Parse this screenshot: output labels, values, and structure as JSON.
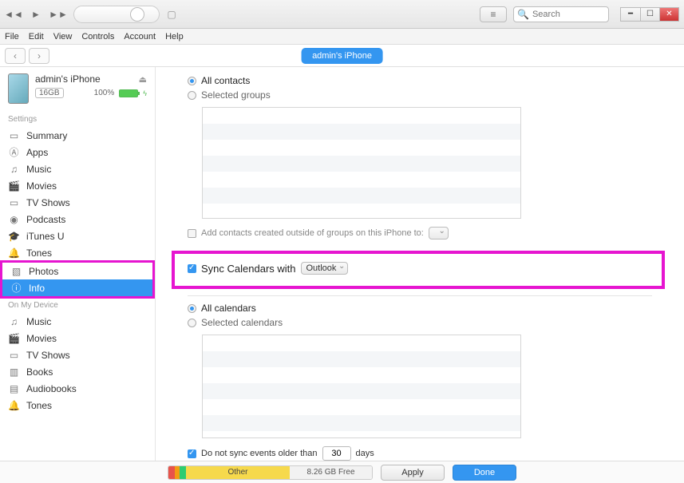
{
  "titlebar": {
    "search_placeholder": "Search"
  },
  "menubar": [
    "File",
    "Edit",
    "View",
    "Controls",
    "Account",
    "Help"
  ],
  "device_pill": "admin's iPhone",
  "device": {
    "name": "admin's iPhone",
    "capacity": "16GB",
    "battery_pct": "100%"
  },
  "sidebar": {
    "settings_label": "Settings",
    "settings_items": [
      {
        "icon": "summary",
        "label": "Summary"
      },
      {
        "icon": "apps",
        "label": "Apps"
      },
      {
        "icon": "music",
        "label": "Music"
      },
      {
        "icon": "movies",
        "label": "Movies"
      },
      {
        "icon": "tvshows",
        "label": "TV Shows"
      },
      {
        "icon": "podcasts",
        "label": "Podcasts"
      },
      {
        "icon": "itunesu",
        "label": "iTunes U"
      },
      {
        "icon": "tones",
        "label": "Tones"
      },
      {
        "icon": "photos",
        "label": "Photos"
      },
      {
        "icon": "info",
        "label": "Info"
      }
    ],
    "ondevice_label": "On My Device",
    "ondevice_items": [
      {
        "icon": "music",
        "label": "Music"
      },
      {
        "icon": "movies",
        "label": "Movies"
      },
      {
        "icon": "tvshows",
        "label": "TV Shows"
      },
      {
        "icon": "books",
        "label": "Books"
      },
      {
        "icon": "audiobooks",
        "label": "Audiobooks"
      },
      {
        "icon": "tones",
        "label": "Tones"
      }
    ]
  },
  "contacts": {
    "all_label": "All contacts",
    "selected_label": "Selected groups",
    "add_outside_label": "Add contacts created outside of groups on this iPhone to:"
  },
  "calendars": {
    "headline": "Sync Calendars with",
    "app": "Outlook",
    "all_label": "All calendars",
    "selected_label": "Selected calendars",
    "older_label_pre": "Do not sync events older than",
    "older_days": "30",
    "older_label_post": "days"
  },
  "footer": {
    "other_label": "Other",
    "free_label": "8.26 GB Free",
    "apply": "Apply",
    "done": "Done"
  }
}
